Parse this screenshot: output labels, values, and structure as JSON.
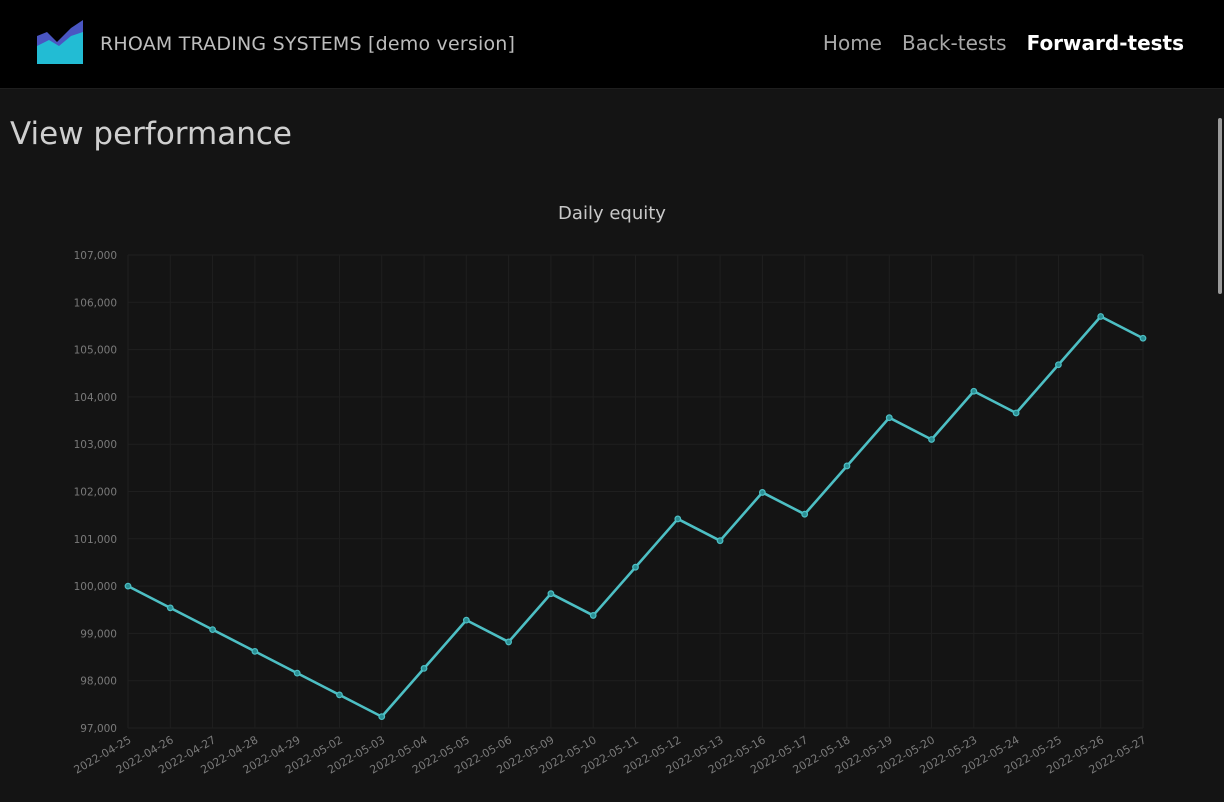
{
  "navbar": {
    "brand": "RHOAM TRADING SYSTEMS [demo version]",
    "links": [
      {
        "label": "Home",
        "active": false
      },
      {
        "label": "Back-tests",
        "active": false
      },
      {
        "label": "Forward-tests",
        "active": true
      }
    ],
    "logo_icon": "area-chart-logo-icon",
    "colors": {
      "logo_back": "#4a56c2",
      "logo_front": "#22bcd4"
    }
  },
  "page": {
    "title": "View performance"
  },
  "chart_data": {
    "type": "line",
    "title": "Daily equity",
    "xlabel": "",
    "ylabel": "",
    "ylim": [
      97000,
      107000
    ],
    "yticks": [
      97000,
      98000,
      99000,
      100000,
      101000,
      102000,
      103000,
      104000,
      105000,
      106000,
      107000
    ],
    "ytick_labels": [
      "97,000",
      "98,000",
      "99,000",
      "100,000",
      "101,000",
      "102,000",
      "103,000",
      "104,000",
      "105,000",
      "106,000",
      "107,000"
    ],
    "grid": true,
    "color": "#4dbfc4",
    "categories": [
      "2022-04-25",
      "2022-04-26",
      "2022-04-27",
      "2022-04-28",
      "2022-04-29",
      "2022-05-02",
      "2022-05-03",
      "2022-05-04",
      "2022-05-05",
      "2022-05-06",
      "2022-05-09",
      "2022-05-10",
      "2022-05-11",
      "2022-05-12",
      "2022-05-13",
      "2022-05-16",
      "2022-05-17",
      "2022-05-18",
      "2022-05-19",
      "2022-05-20",
      "2022-05-23",
      "2022-05-24",
      "2022-05-25",
      "2022-05-26",
      "2022-05-27"
    ],
    "values": [
      100000,
      99540,
      99080,
      98620,
      98160,
      97700,
      97240,
      98260,
      99280,
      98820,
      99840,
      99380,
      100400,
      101420,
      100960,
      101980,
      101520,
      102540,
      103560,
      103100,
      104120,
      103660,
      104680,
      105700,
      105240
    ]
  }
}
